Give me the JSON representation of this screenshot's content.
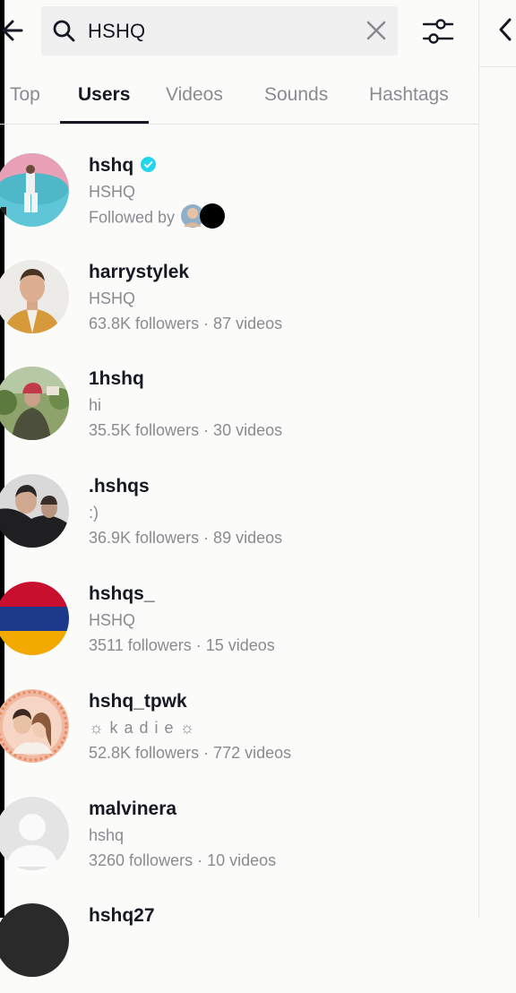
{
  "search": {
    "query": "HSHQ"
  },
  "tabs": [
    {
      "label": "Top"
    },
    {
      "label": "Users"
    },
    {
      "label": "Videos"
    },
    {
      "label": "Sounds"
    },
    {
      "label": "Hashtags"
    }
  ],
  "active_tab": "Users",
  "users": [
    {
      "username": "hshq",
      "nickname": "HSHQ",
      "followed_by": "Followed by",
      "verified": true
    },
    {
      "username": "harrystylek",
      "nickname": "HSHQ",
      "stats": "63.8K followers · 87 videos"
    },
    {
      "username": "1hshq",
      "nickname": "hi",
      "stats": "35.5K followers · 30 videos"
    },
    {
      "username": ".hshqs",
      "nickname": ":)",
      "stats": "36.9K followers · 89 videos"
    },
    {
      "username": "hshqs_",
      "nickname": "HSHQ",
      "stats": "3511 followers · 15 videos"
    },
    {
      "username": "hshq_tpwk",
      "nickname": "☼ k a d i e ☼",
      "stats": "52.8K followers · 772 videos"
    },
    {
      "username": "malvinera",
      "nickname": "hshq",
      "stats": "3260 followers · 10 videos"
    },
    {
      "username": "hshq27"
    }
  ],
  "colors": {
    "verified": "#20d5ec",
    "primary_text": "#161823",
    "secondary_text": "#8a8b91",
    "search_bg": "#f0f0f0"
  }
}
